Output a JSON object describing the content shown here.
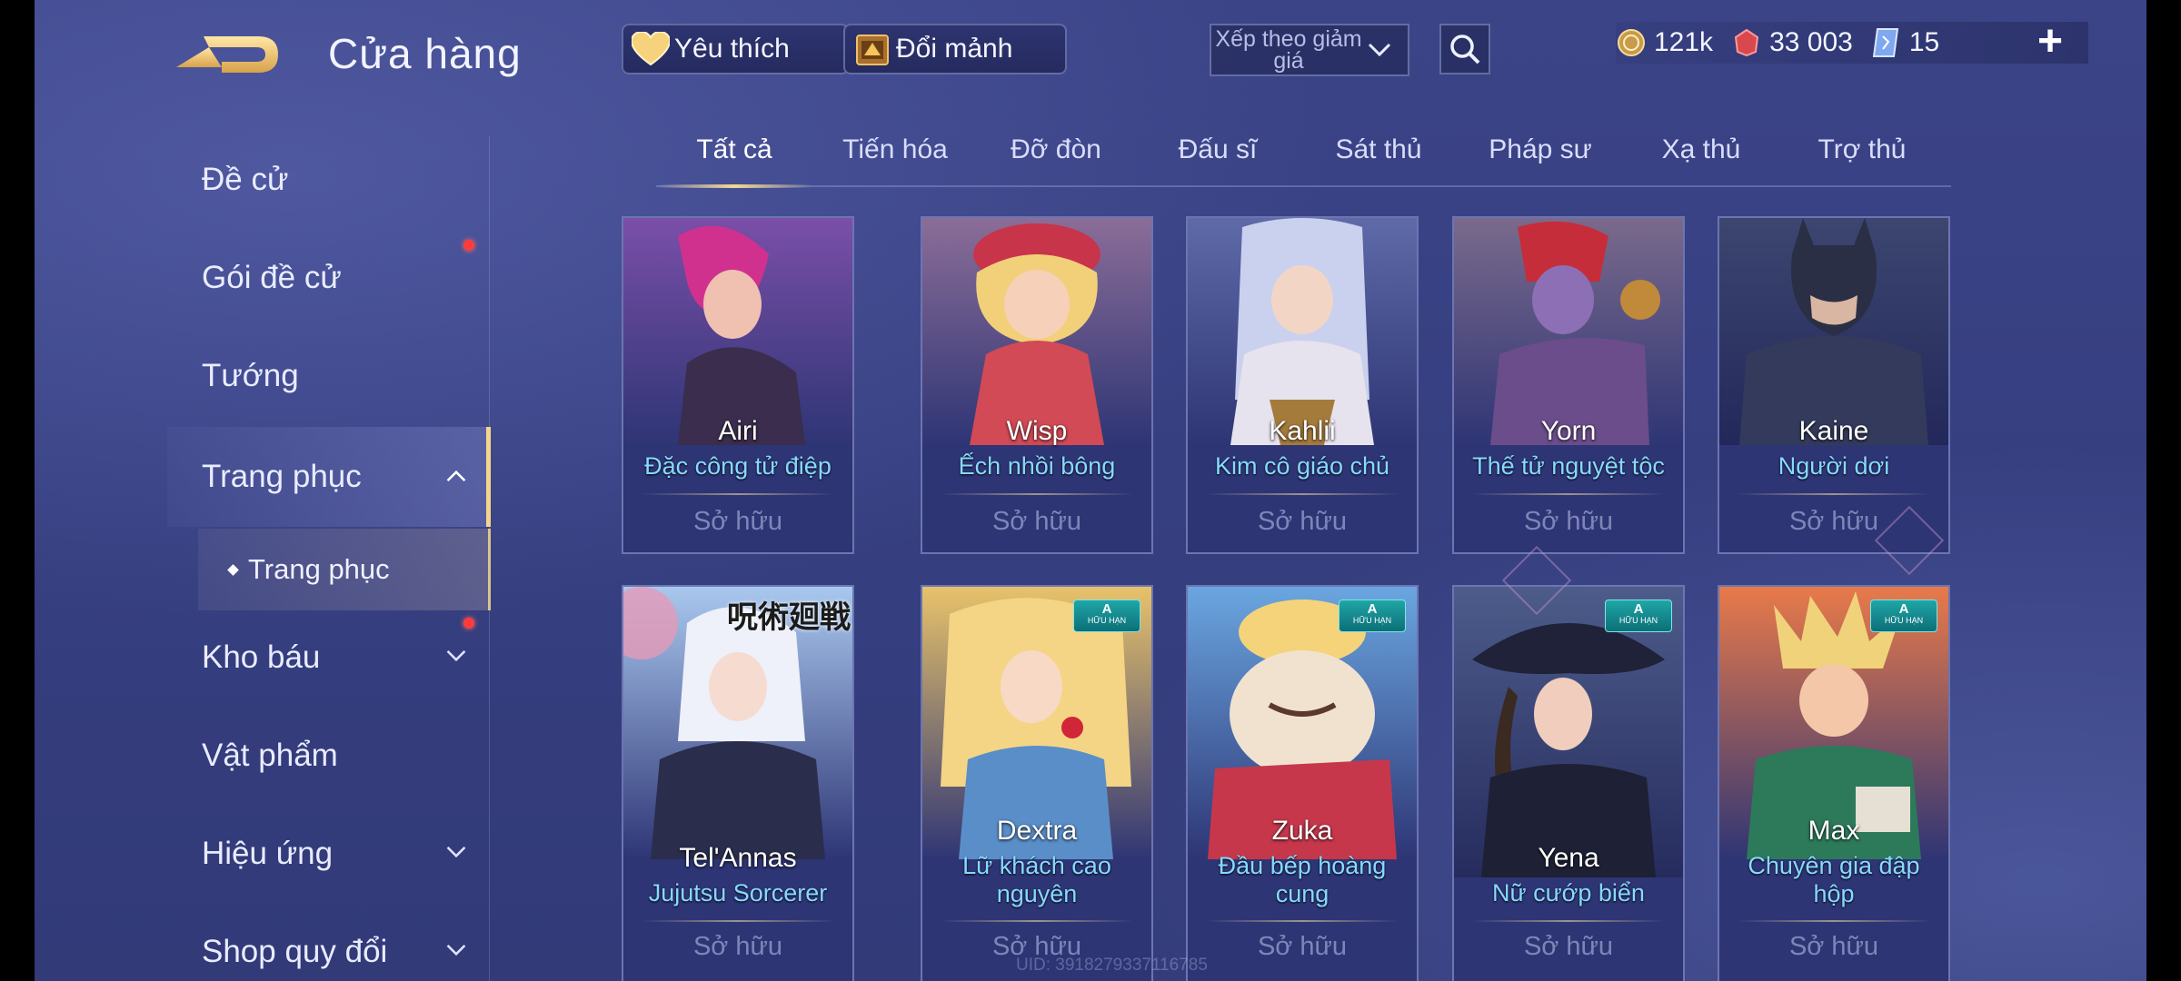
{
  "header": {
    "title": "Cửa hàng",
    "favorites_label": "Yêu thích",
    "exchange_label": "Đổi mảnh",
    "sort_label": "Xếp theo giảm giá",
    "icons": {
      "back": "back-arrow-icon",
      "search": "search-icon",
      "plus": "plus-icon"
    }
  },
  "currencies": {
    "gold": "121k",
    "quan_huy": "33 003",
    "vouchers": "15",
    "colors": {
      "gold": "#e6c677",
      "quan_huy": "#e2585e",
      "vouchers": "#8fb9ff"
    }
  },
  "sidebar": {
    "items": [
      {
        "label": "Đề cử"
      },
      {
        "label": "Gói đề cử"
      },
      {
        "label": "Tướng"
      },
      {
        "label": "Trang phục"
      },
      {
        "label": "Kho báu"
      },
      {
        "label": "Vật phẩm"
      },
      {
        "label": "Hiệu ứng"
      },
      {
        "label": "Shop quy đổi"
      }
    ],
    "sub_item": "Trang phục"
  },
  "tabs": [
    "Tất cả",
    "Tiến hóa",
    "Đỡ đòn",
    "Đấu sĩ",
    "Sát thủ",
    "Pháp sư",
    "Xạ thủ",
    "Trợ thủ"
  ],
  "cards": [
    {
      "hero": "Airi",
      "skin": "Đặc công tử điệp",
      "status": "Sở hữu"
    },
    {
      "hero": "Wisp",
      "skin": "Ếch nhồi bông",
      "status": "Sở hữu"
    },
    {
      "hero": "Kahlii",
      "skin": "Kim cô giáo chủ",
      "status": "Sở hữu"
    },
    {
      "hero": "Yorn",
      "skin": "Thế tử nguyệt tộc",
      "status": "Sở hữu"
    },
    {
      "hero": "Kaine",
      "skin": "Người dơi",
      "status": "Sở hữu"
    },
    {
      "hero": "Tel'Annas",
      "skin": "Jujutsu Sorcerer",
      "status": "Sở hữu"
    },
    {
      "hero": "Dextra",
      "skin": "Lữ khách cao nguyên",
      "status": "Sở hữu"
    },
    {
      "hero": "Zuka",
      "skin": "Đầu bếp hoàng cung",
      "status": "Sở hữu"
    },
    {
      "hero": "Yena",
      "skin": "Nữ cướp biển",
      "status": "Sở hữu"
    },
    {
      "hero": "Max",
      "skin": "Chuyên gia đập hộp",
      "status": "Sở hữu"
    }
  ],
  "badge": {
    "tier": "A",
    "text": "HỮU HẠN"
  },
  "jujutsu_logo": "呪術廻戦",
  "uid": "UID: 3918279337116785"
}
